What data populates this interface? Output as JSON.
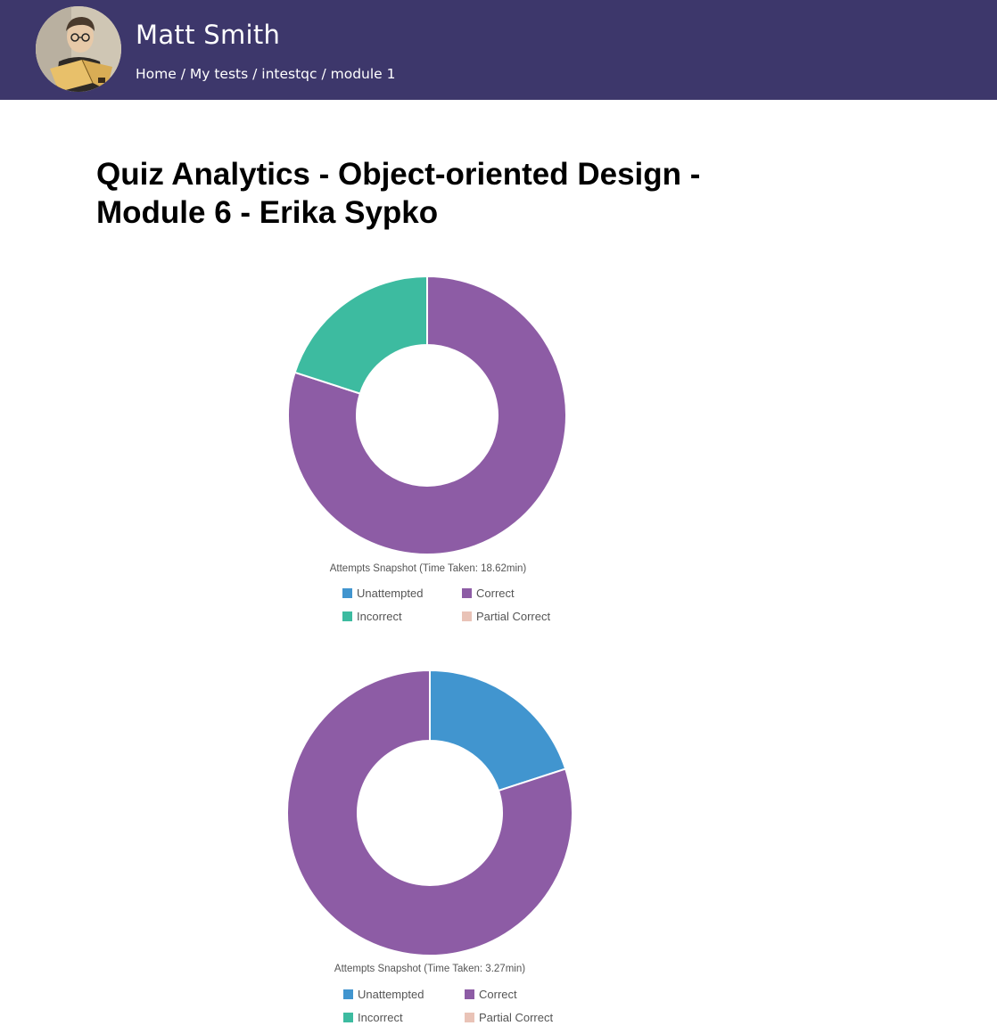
{
  "header": {
    "user_name": "Matt Smith",
    "breadcrumb": [
      "Home",
      "My tests",
      "intestqc",
      "module 1"
    ],
    "breadcrumb_separator": " / "
  },
  "page": {
    "title": "Quiz Analytics - Object-oriented Design - Module 6 - Erika Sypko"
  },
  "colors": {
    "header_bg": "#3d376b",
    "unattempted": "#4195cf",
    "correct": "#8d5ca5",
    "incorrect": "#3dbba0",
    "partial_correct": "#e9c3b7"
  },
  "chart_data": [
    {
      "type": "pie",
      "donut": true,
      "caption": "Attempts Snapshot (Time Taken: 18.62min)",
      "labels": [
        "Unattempted",
        "Correct",
        "Incorrect",
        "Partial Correct"
      ],
      "values": [
        0,
        80,
        20,
        0
      ],
      "colors": [
        "#4195cf",
        "#8d5ca5",
        "#3dbba0",
        "#e9c3b7"
      ]
    },
    {
      "type": "pie",
      "donut": true,
      "caption": "Attempts Snapshot (Time Taken: 3.27min)",
      "labels": [
        "Unattempted",
        "Correct",
        "Incorrect",
        "Partial Correct"
      ],
      "values": [
        20,
        80,
        0,
        0
      ],
      "colors": [
        "#4195cf",
        "#8d5ca5",
        "#3dbba0",
        "#e9c3b7"
      ]
    }
  ]
}
